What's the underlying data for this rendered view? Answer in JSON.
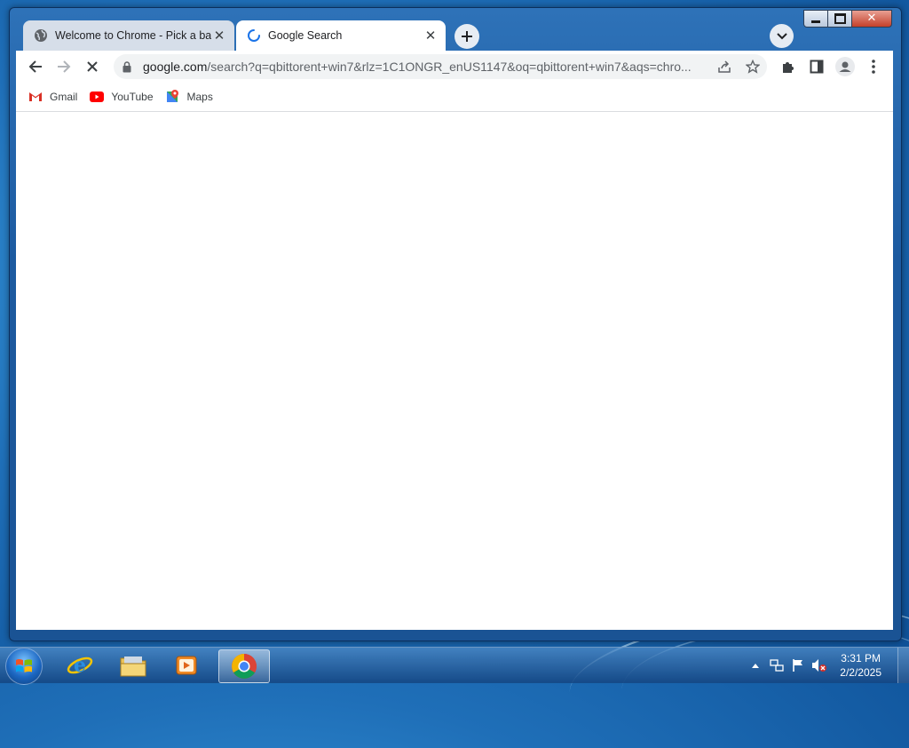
{
  "window": {
    "minimize_label": "",
    "maximize_label": "",
    "close_label": "✕"
  },
  "tabs": [
    {
      "title": "Welcome to Chrome - Pick a background",
      "favicon": "globe-icon",
      "close": "✕"
    },
    {
      "title": "Google Search",
      "favicon": "loading-spinner-icon",
      "close": "✕"
    }
  ],
  "toolbar": {
    "url_domain": "google.com",
    "url_path": "/search?q=qbittorent+win7&rlz=1C1ONGR_enUS1147&oq=qbittorent+win7&aqs=chro..."
  },
  "bookmarks": [
    {
      "label": "Gmail",
      "icon": "gmail-icon"
    },
    {
      "label": "YouTube",
      "icon": "youtube-icon"
    },
    {
      "label": "Maps",
      "icon": "maps-icon"
    }
  ],
  "taskbar": {
    "apps": [
      {
        "name": "internet-explorer",
        "icon": "ie-icon"
      },
      {
        "name": "file-explorer",
        "icon": "folder-icon"
      },
      {
        "name": "media-player",
        "icon": "media-player-icon"
      },
      {
        "name": "chrome",
        "icon": "chrome-icon",
        "active": true
      }
    ],
    "time": "3:31 PM",
    "date": "2/2/2025"
  },
  "colors": {
    "accent_blue": "#1a73e8",
    "desktop_blue": "#1f6fb8",
    "tab_inactive": "#d6dee9"
  }
}
